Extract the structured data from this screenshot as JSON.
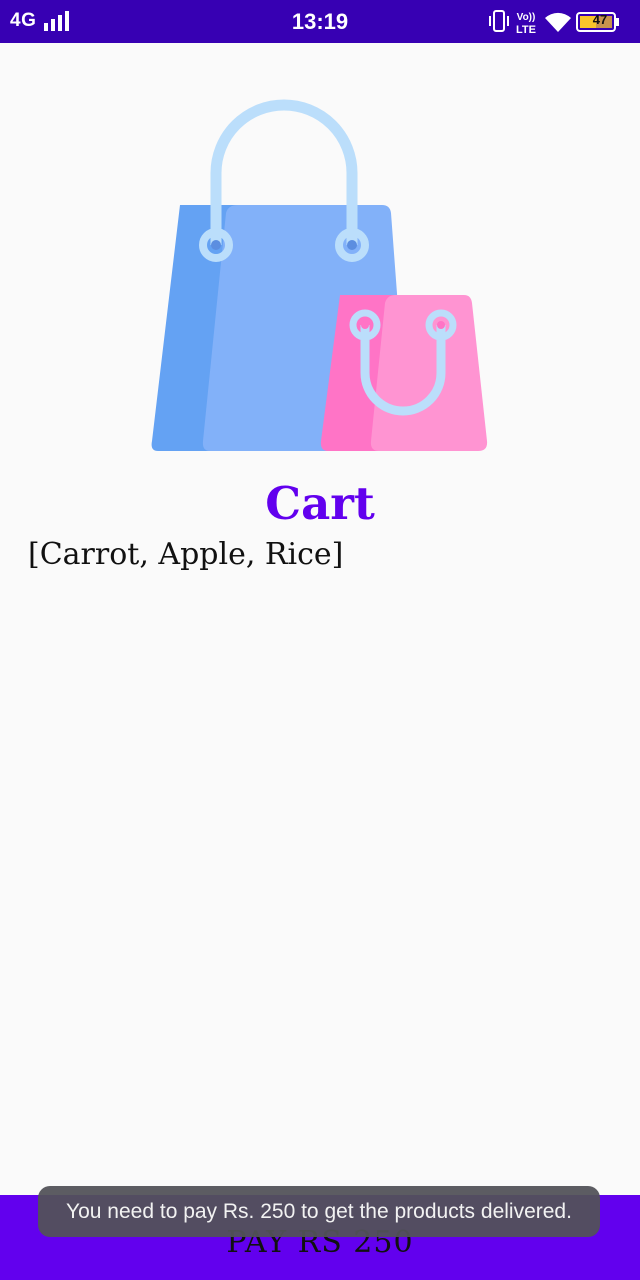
{
  "status_bar": {
    "network": "4G",
    "time": "13:19",
    "volte_top": "Vo))",
    "volte_bottom": "LTE",
    "battery_level": "47"
  },
  "main": {
    "title": "Cart",
    "items_text": "[Carrot, Apple, Rice]"
  },
  "pay_bar": {
    "label": "PAY RS 250"
  },
  "toast": {
    "message": "You need to pay Rs. 250 to get the products delivered."
  },
  "colors": {
    "status_bar": "#3700b3",
    "accent": "#6200ee",
    "bag_blue": "#82b1f9",
    "bag_blue_dark": "#64a2f3",
    "bag_pink": "#ff94d2",
    "bag_pink_dark": "#ff74c6",
    "handle": "#bbdefb"
  }
}
